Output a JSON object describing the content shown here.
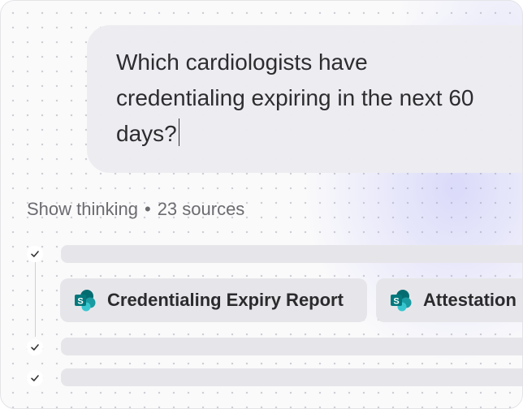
{
  "prompt": {
    "text": "Which cardiologists have credentialing expiring in the next 60 days?"
  },
  "thinking": {
    "label": "Show thinking",
    "separator": "•",
    "sources": "23 sources"
  },
  "sources": [
    {
      "label": "Credentialing Expiry Report",
      "icon": "sharepoint-icon"
    },
    {
      "label": "Attestation",
      "icon": "sharepoint-icon"
    }
  ],
  "colors": {
    "sharepoint_dark": "#036c70",
    "sharepoint_mid": "#1a9ba1",
    "sharepoint_light": "#37c6d0"
  }
}
